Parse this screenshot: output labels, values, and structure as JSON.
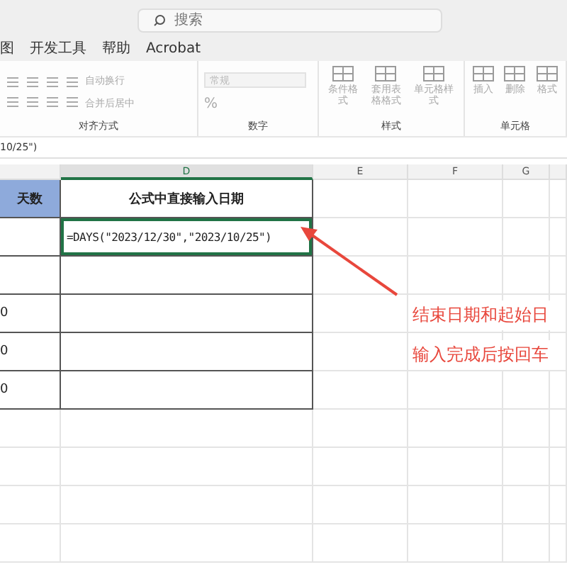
{
  "search": {
    "placeholder": "搜索"
  },
  "menu": [
    {
      "label": "图"
    },
    {
      "label": "开发工具"
    },
    {
      "label": "帮助"
    },
    {
      "label": "Acrobat"
    }
  ],
  "ribbon": {
    "alignment": {
      "label": "对齐方式",
      "wrap": "自动换行",
      "merge": "合并后居中"
    },
    "number": {
      "label": "数字",
      "format": "常规",
      "percent": "%"
    },
    "styles": {
      "label": "样式",
      "buttons": [
        "条件格式",
        "套用表格格式",
        "单元格样式"
      ]
    },
    "cells": {
      "label": "单元格",
      "buttons": [
        "插入",
        "删除",
        "格式"
      ]
    }
  },
  "formula_bar": {
    "value": "10/25\")"
  },
  "columns": [
    {
      "label": "D",
      "selected": true
    },
    {
      "label": "E",
      "selected": false
    },
    {
      "label": "F",
      "selected": false
    },
    {
      "label": "G",
      "selected": false
    }
  ],
  "rows": [
    {
      "kind": "header",
      "cells": [
        "天数",
        "公式中直接输入日期"
      ],
      "editing": false
    },
    {
      "kind": "data",
      "cells": [
        "",
        "=DAYS(\"2023/12/30\",\"2023/10/25\")"
      ],
      "editing": true
    },
    {
      "kind": "data",
      "cells": [
        "",
        ""
      ],
      "editing": false
    },
    {
      "kind": "data",
      "cells": [
        "0",
        ""
      ],
      "editing": false
    },
    {
      "kind": "data",
      "cells": [
        "0",
        ""
      ],
      "editing": false
    },
    {
      "kind": "data",
      "cells": [
        "0",
        ""
      ],
      "editing": false
    }
  ],
  "annotations": [
    "结束日期和起始日",
    "输入完成后按回车"
  ]
}
